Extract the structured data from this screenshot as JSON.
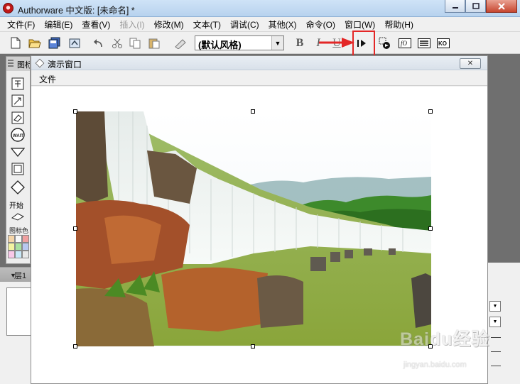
{
  "window": {
    "title": "Authorware 中文版: [未命名] *",
    "controls": [
      "minimize",
      "maximize",
      "close"
    ]
  },
  "menubar": {
    "items": [
      {
        "label": "文件(F)",
        "disabled": false
      },
      {
        "label": "编辑(E)",
        "disabled": false
      },
      {
        "label": "查看(V)",
        "disabled": false
      },
      {
        "label": "插入(I)",
        "disabled": true
      },
      {
        "label": "修改(M)",
        "disabled": false
      },
      {
        "label": "文本(T)",
        "disabled": false
      },
      {
        "label": "调试(C)",
        "disabled": false
      },
      {
        "label": "其他(X)",
        "disabled": false
      },
      {
        "label": "命令(O)",
        "disabled": false
      },
      {
        "label": "窗口(W)",
        "disabled": false
      },
      {
        "label": "帮助(H)",
        "disabled": false
      }
    ]
  },
  "toolbar": {
    "style_select_value": "(默认风格)",
    "bold_label": "B",
    "italic_label": "I",
    "underline_label": "U",
    "highlighted_button": "restart-button",
    "icons": [
      "new-file-icon",
      "open-folder-icon",
      "save-all-icon",
      "import-icon",
      "undo-icon",
      "cut-icon",
      "copy-icon",
      "paste-icon",
      "find-icon",
      "restart-icon",
      "control-panel-icon",
      "functions-icon",
      "variables-icon",
      "knowledge-objects-icon"
    ],
    "functions_glyph": "fO",
    "ko_glyph": "KO"
  },
  "icon_palette": {
    "header": "图标",
    "start_label": "开始",
    "color_label": "图标色彩",
    "icons": [
      "display-icon",
      "motion-icon",
      "erase-icon",
      "wait-icon",
      "navigate-icon",
      "framework-icon",
      "decision-icon"
    ],
    "wait_text": "WAIT",
    "swatch_colors": [
      "#f5d5a8",
      "#f8f8f8",
      "#f0a0a0",
      "#f3f3a0",
      "#a8e0a0",
      "#b8c8f0",
      "#f8c8e8",
      "#c8e8f8",
      "#e8e8e8"
    ]
  },
  "lower_panel": {
    "header": "层1"
  },
  "presentation_window": {
    "title": "演示窗口",
    "menu_file": "文件",
    "close_symbol": "✕"
  },
  "watermark": {
    "brand": "Baidu经验",
    "url": "jingyan.baidu.com"
  },
  "colors": {
    "highlight": "#e32626",
    "titlebar": "#c4dbf3",
    "background": "#6f6f6f"
  }
}
